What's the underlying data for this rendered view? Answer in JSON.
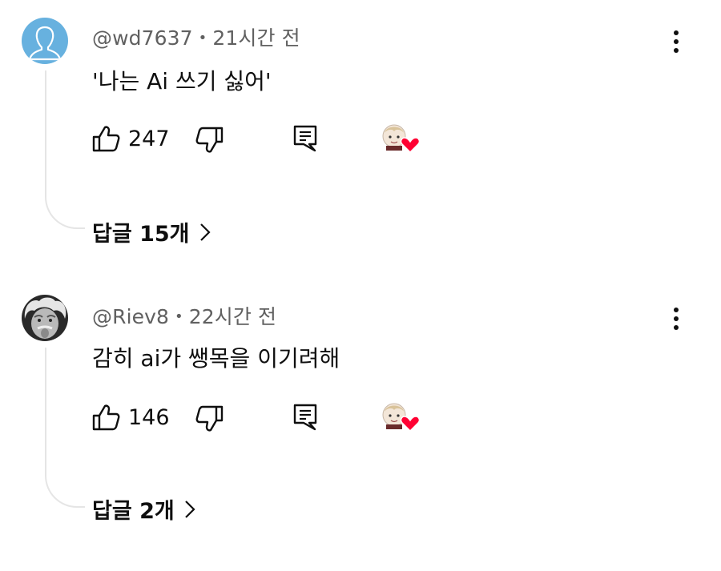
{
  "comments": [
    {
      "author": "@wd7637",
      "separator": "•",
      "time": "21시간 전",
      "text": "'나는 Ai 쓰기 싫어'",
      "likes": "247",
      "replies": "답글 15개",
      "avatar_icon": "default-person-avatar",
      "heart_color": "#ff0033"
    },
    {
      "author": "@Riev8",
      "separator": "•",
      "time": "22시간 전",
      "text": "감히 ai가 쌩목을 이기려해",
      "likes": "146",
      "replies": "답글 2개",
      "avatar_icon": "photo-avatar",
      "heart_color": "#ff0033"
    }
  ],
  "icons": {
    "like": "thumbs-up-icon",
    "dislike": "thumbs-down-icon",
    "reply": "comment-reply-icon",
    "more": "more-vertical-icon",
    "creator_heart": "creator-heart-icon",
    "chevron": "chevron-right-icon"
  }
}
